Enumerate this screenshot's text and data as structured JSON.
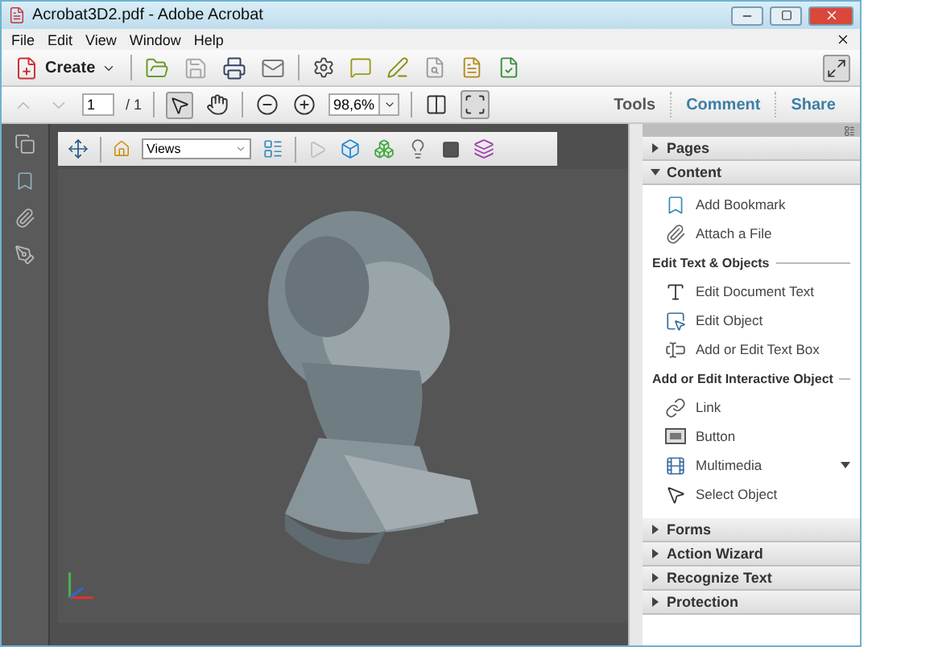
{
  "window": {
    "title": "Acrobat3D2.pdf - Adobe Acrobat"
  },
  "menu": [
    {
      "label": "File"
    },
    {
      "label": "Edit"
    },
    {
      "label": "View"
    },
    {
      "label": "Window"
    },
    {
      "label": "Help"
    }
  ],
  "toolbar": {
    "create": "Create"
  },
  "navigation": {
    "page": "1",
    "page_count": "/ 1",
    "zoom": "98,6%"
  },
  "task_tabs": [
    {
      "label": "Tools",
      "selected": true
    },
    {
      "label": "Comment",
      "selected": false
    },
    {
      "label": "Share",
      "selected": false
    }
  ],
  "viewer_toolbar": {
    "views": "Views"
  },
  "panel": {
    "sections": [
      {
        "title": "Pages",
        "expanded": false
      },
      {
        "title": "Content",
        "expanded": true,
        "items": [
          {
            "kind": "tool",
            "label": "Add Bookmark",
            "has_menu": false
          },
          {
            "kind": "tool",
            "label": "Attach a File",
            "has_menu": false
          },
          {
            "kind": "heading",
            "label": "Edit Text & Objects"
          },
          {
            "kind": "tool",
            "label": "Edit Document Text",
            "has_menu": false
          },
          {
            "kind": "tool",
            "label": "Edit Object",
            "has_menu": false
          },
          {
            "kind": "tool",
            "label": "Add or Edit Text Box",
            "has_menu": false
          },
          {
            "kind": "heading",
            "label": "Add or Edit Interactive Object"
          },
          {
            "kind": "tool",
            "label": "Link",
            "has_menu": false
          },
          {
            "kind": "tool",
            "label": "Button",
            "has_menu": false
          },
          {
            "kind": "tool",
            "label": "Multimedia",
            "has_menu": true
          },
          {
            "kind": "tool",
            "label": "Select Object",
            "has_menu": false
          }
        ]
      },
      {
        "title": "Forms",
        "expanded": false
      },
      {
        "title": "Action Wizard",
        "expanded": false
      },
      {
        "title": "Recognize Text",
        "expanded": false
      },
      {
        "title": "Protection",
        "expanded": false
      }
    ]
  }
}
